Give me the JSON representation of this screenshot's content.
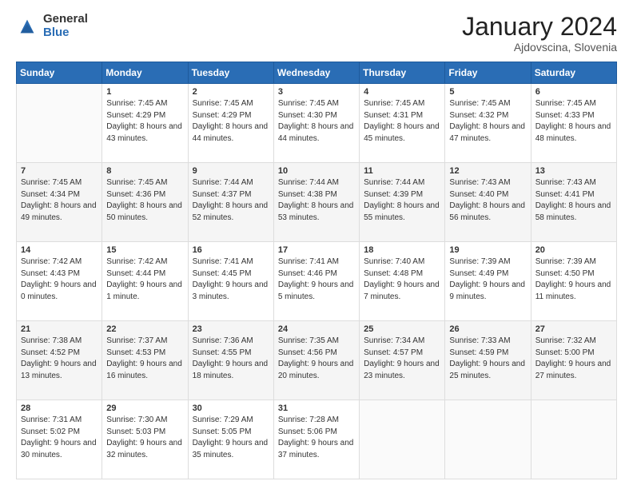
{
  "logo": {
    "general": "General",
    "blue": "Blue"
  },
  "title": {
    "month_year": "January 2024",
    "location": "Ajdovscina, Slovenia"
  },
  "days_of_week": [
    "Sunday",
    "Monday",
    "Tuesday",
    "Wednesday",
    "Thursday",
    "Friday",
    "Saturday"
  ],
  "weeks": [
    [
      {
        "num": "",
        "sunrise": "",
        "sunset": "",
        "daylight": ""
      },
      {
        "num": "1",
        "sunrise": "Sunrise: 7:45 AM",
        "sunset": "Sunset: 4:29 PM",
        "daylight": "Daylight: 8 hours and 43 minutes."
      },
      {
        "num": "2",
        "sunrise": "Sunrise: 7:45 AM",
        "sunset": "Sunset: 4:29 PM",
        "daylight": "Daylight: 8 hours and 44 minutes."
      },
      {
        "num": "3",
        "sunrise": "Sunrise: 7:45 AM",
        "sunset": "Sunset: 4:30 PM",
        "daylight": "Daylight: 8 hours and 44 minutes."
      },
      {
        "num": "4",
        "sunrise": "Sunrise: 7:45 AM",
        "sunset": "Sunset: 4:31 PM",
        "daylight": "Daylight: 8 hours and 45 minutes."
      },
      {
        "num": "5",
        "sunrise": "Sunrise: 7:45 AM",
        "sunset": "Sunset: 4:32 PM",
        "daylight": "Daylight: 8 hours and 47 minutes."
      },
      {
        "num": "6",
        "sunrise": "Sunrise: 7:45 AM",
        "sunset": "Sunset: 4:33 PM",
        "daylight": "Daylight: 8 hours and 48 minutes."
      }
    ],
    [
      {
        "num": "7",
        "sunrise": "Sunrise: 7:45 AM",
        "sunset": "Sunset: 4:34 PM",
        "daylight": "Daylight: 8 hours and 49 minutes."
      },
      {
        "num": "8",
        "sunrise": "Sunrise: 7:45 AM",
        "sunset": "Sunset: 4:36 PM",
        "daylight": "Daylight: 8 hours and 50 minutes."
      },
      {
        "num": "9",
        "sunrise": "Sunrise: 7:44 AM",
        "sunset": "Sunset: 4:37 PM",
        "daylight": "Daylight: 8 hours and 52 minutes."
      },
      {
        "num": "10",
        "sunrise": "Sunrise: 7:44 AM",
        "sunset": "Sunset: 4:38 PM",
        "daylight": "Daylight: 8 hours and 53 minutes."
      },
      {
        "num": "11",
        "sunrise": "Sunrise: 7:44 AM",
        "sunset": "Sunset: 4:39 PM",
        "daylight": "Daylight: 8 hours and 55 minutes."
      },
      {
        "num": "12",
        "sunrise": "Sunrise: 7:43 AM",
        "sunset": "Sunset: 4:40 PM",
        "daylight": "Daylight: 8 hours and 56 minutes."
      },
      {
        "num": "13",
        "sunrise": "Sunrise: 7:43 AM",
        "sunset": "Sunset: 4:41 PM",
        "daylight": "Daylight: 8 hours and 58 minutes."
      }
    ],
    [
      {
        "num": "14",
        "sunrise": "Sunrise: 7:42 AM",
        "sunset": "Sunset: 4:43 PM",
        "daylight": "Daylight: 9 hours and 0 minutes."
      },
      {
        "num": "15",
        "sunrise": "Sunrise: 7:42 AM",
        "sunset": "Sunset: 4:44 PM",
        "daylight": "Daylight: 9 hours and 1 minute."
      },
      {
        "num": "16",
        "sunrise": "Sunrise: 7:41 AM",
        "sunset": "Sunset: 4:45 PM",
        "daylight": "Daylight: 9 hours and 3 minutes."
      },
      {
        "num": "17",
        "sunrise": "Sunrise: 7:41 AM",
        "sunset": "Sunset: 4:46 PM",
        "daylight": "Daylight: 9 hours and 5 minutes."
      },
      {
        "num": "18",
        "sunrise": "Sunrise: 7:40 AM",
        "sunset": "Sunset: 4:48 PM",
        "daylight": "Daylight: 9 hours and 7 minutes."
      },
      {
        "num": "19",
        "sunrise": "Sunrise: 7:39 AM",
        "sunset": "Sunset: 4:49 PM",
        "daylight": "Daylight: 9 hours and 9 minutes."
      },
      {
        "num": "20",
        "sunrise": "Sunrise: 7:39 AM",
        "sunset": "Sunset: 4:50 PM",
        "daylight": "Daylight: 9 hours and 11 minutes."
      }
    ],
    [
      {
        "num": "21",
        "sunrise": "Sunrise: 7:38 AM",
        "sunset": "Sunset: 4:52 PM",
        "daylight": "Daylight: 9 hours and 13 minutes."
      },
      {
        "num": "22",
        "sunrise": "Sunrise: 7:37 AM",
        "sunset": "Sunset: 4:53 PM",
        "daylight": "Daylight: 9 hours and 16 minutes."
      },
      {
        "num": "23",
        "sunrise": "Sunrise: 7:36 AM",
        "sunset": "Sunset: 4:55 PM",
        "daylight": "Daylight: 9 hours and 18 minutes."
      },
      {
        "num": "24",
        "sunrise": "Sunrise: 7:35 AM",
        "sunset": "Sunset: 4:56 PM",
        "daylight": "Daylight: 9 hours and 20 minutes."
      },
      {
        "num": "25",
        "sunrise": "Sunrise: 7:34 AM",
        "sunset": "Sunset: 4:57 PM",
        "daylight": "Daylight: 9 hours and 23 minutes."
      },
      {
        "num": "26",
        "sunrise": "Sunrise: 7:33 AM",
        "sunset": "Sunset: 4:59 PM",
        "daylight": "Daylight: 9 hours and 25 minutes."
      },
      {
        "num": "27",
        "sunrise": "Sunrise: 7:32 AM",
        "sunset": "Sunset: 5:00 PM",
        "daylight": "Daylight: 9 hours and 27 minutes."
      }
    ],
    [
      {
        "num": "28",
        "sunrise": "Sunrise: 7:31 AM",
        "sunset": "Sunset: 5:02 PM",
        "daylight": "Daylight: 9 hours and 30 minutes."
      },
      {
        "num": "29",
        "sunrise": "Sunrise: 7:30 AM",
        "sunset": "Sunset: 5:03 PM",
        "daylight": "Daylight: 9 hours and 32 minutes."
      },
      {
        "num": "30",
        "sunrise": "Sunrise: 7:29 AM",
        "sunset": "Sunset: 5:05 PM",
        "daylight": "Daylight: 9 hours and 35 minutes."
      },
      {
        "num": "31",
        "sunrise": "Sunrise: 7:28 AM",
        "sunset": "Sunset: 5:06 PM",
        "daylight": "Daylight: 9 hours and 37 minutes."
      },
      {
        "num": "",
        "sunrise": "",
        "sunset": "",
        "daylight": ""
      },
      {
        "num": "",
        "sunrise": "",
        "sunset": "",
        "daylight": ""
      },
      {
        "num": "",
        "sunrise": "",
        "sunset": "",
        "daylight": ""
      }
    ]
  ]
}
